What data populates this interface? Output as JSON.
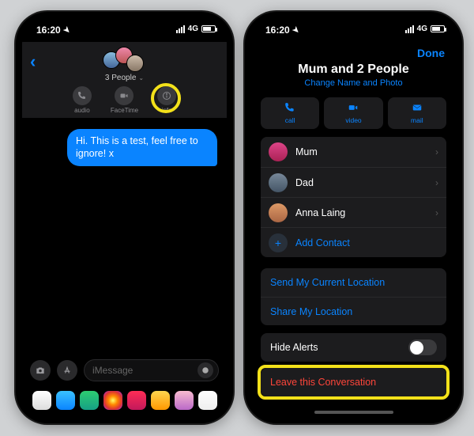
{
  "status": {
    "time": "16:20",
    "net": "4G"
  },
  "left": {
    "group_label": "3 People",
    "header_icons": {
      "audio": "audio",
      "facetime": "FaceTime",
      "info": "info"
    },
    "message": "Hi. This is a test, feel free to ignore! x",
    "input_placeholder": "iMessage"
  },
  "right": {
    "done": "Done",
    "title": "Mum and 2 People",
    "subtitle": "Change Name and Photo",
    "actions": {
      "call": "call",
      "video": "video",
      "mail": "mail"
    },
    "people": [
      {
        "name": "Mum"
      },
      {
        "name": "Dad"
      },
      {
        "name": "Anna Laing"
      }
    ],
    "add_contact": "Add Contact",
    "send_location": "Send My Current Location",
    "share_location": "Share My Location",
    "hide_alerts": "Hide Alerts",
    "leave": "Leave this Conversation"
  }
}
